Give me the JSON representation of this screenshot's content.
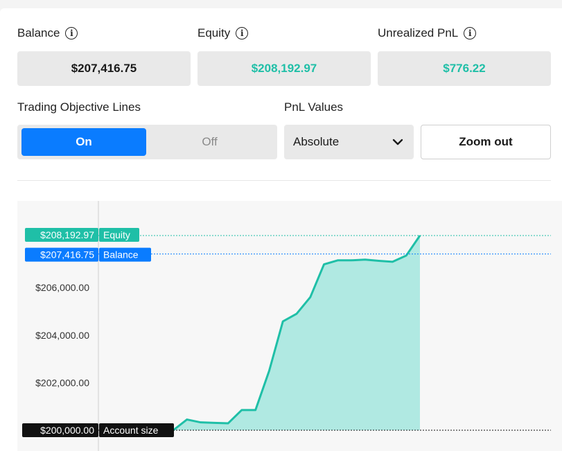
{
  "stats": {
    "balance": {
      "label": "Balance",
      "value": "$207,416.75",
      "value_color": "#1a1a1a"
    },
    "equity": {
      "label": "Equity",
      "value": "$208,192.97",
      "value_color": "#1fbfa7"
    },
    "unrealized": {
      "label": "Unrealized PnL",
      "value": "$776.22",
      "value_color": "#1fbfa7"
    }
  },
  "objective_lines": {
    "label": "Trading Objective Lines",
    "on": "On",
    "off": "Off",
    "selected": "On"
  },
  "pnl_values": {
    "label": "PnL Values",
    "selected": "Absolute"
  },
  "zoom_out_label": "Zoom out",
  "colors": {
    "accent_blue": "#0a7cff",
    "equity_teal": "#1fbfa7",
    "fill_teal": "#b0e9e2",
    "account_black": "#111111"
  },
  "chart_data": {
    "type": "area",
    "y_ticks": [
      "$206,000.00",
      "$204,000.00",
      "$202,000.00"
    ],
    "ylim": [
      199970,
      208600
    ],
    "equity_series": [
      [
        0,
        200000
      ],
      [
        1,
        200450
      ],
      [
        2,
        200330
      ],
      [
        3,
        200310
      ],
      [
        4,
        200290
      ],
      [
        5,
        200850
      ],
      [
        6,
        200850
      ],
      [
        7,
        202500
      ],
      [
        8,
        204580
      ],
      [
        9,
        204900
      ],
      [
        10,
        205600
      ],
      [
        11,
        206980
      ],
      [
        12,
        207150
      ],
      [
        13,
        207150
      ],
      [
        14,
        207180
      ],
      [
        15,
        207130
      ],
      [
        16,
        207090
      ],
      [
        17,
        207350
      ],
      [
        18,
        208193
      ]
    ],
    "labels": {
      "equity": {
        "value": "$208,192.97",
        "name": "Equity",
        "y": 208192.97
      },
      "balance": {
        "value": "$207,416.75",
        "name": "Balance",
        "y": 207416.75
      },
      "account": {
        "value": "$200,000.00",
        "name": "Account size",
        "y": 200000
      }
    }
  }
}
